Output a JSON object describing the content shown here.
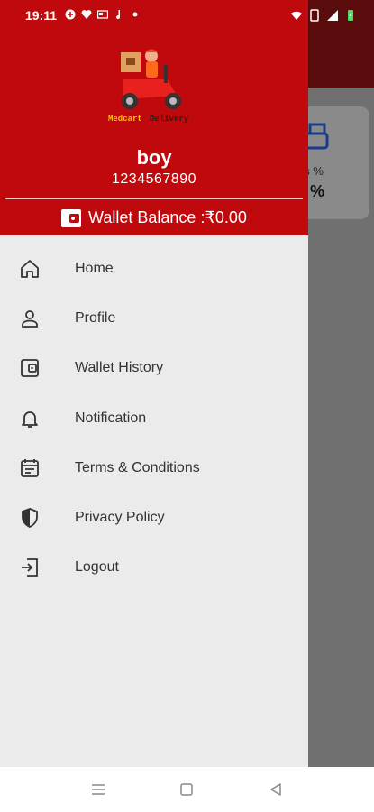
{
  "status_bar": {
    "time": "19:11",
    "left_icons": [
      "app-notification-icon",
      "heart-icon",
      "card-icon",
      "music-icon",
      "dot-icon"
    ],
    "right_icons": [
      "wifi-icon",
      "sim-icon",
      "signal-icon",
      "battery-charging-icon"
    ]
  },
  "background_screen": {
    "card_label": "us %",
    "card_value": "%"
  },
  "drawer": {
    "logo_text": "Medcart Delivery",
    "user_name": "boy",
    "user_phone": "1234567890",
    "wallet_label": "Wallet Balance :₹0.00",
    "menu": [
      {
        "label": "Home",
        "icon": "home-icon"
      },
      {
        "label": "Profile",
        "icon": "user-icon"
      },
      {
        "label": "Wallet History",
        "icon": "wallet-icon"
      },
      {
        "label": "Notification",
        "icon": "bell-icon"
      },
      {
        "label": "Terms & Conditions",
        "icon": "calendar-icon"
      },
      {
        "label": "Privacy Policy",
        "icon": "shield-icon"
      },
      {
        "label": "Logout",
        "icon": "logout-icon"
      }
    ]
  },
  "colors": {
    "primary": "#c0090c",
    "drawer_bg": "#ebebeb",
    "text": "#333333"
  },
  "navbar": {
    "buttons": [
      "menu-nav-icon",
      "home-nav-icon",
      "back-nav-icon"
    ]
  }
}
